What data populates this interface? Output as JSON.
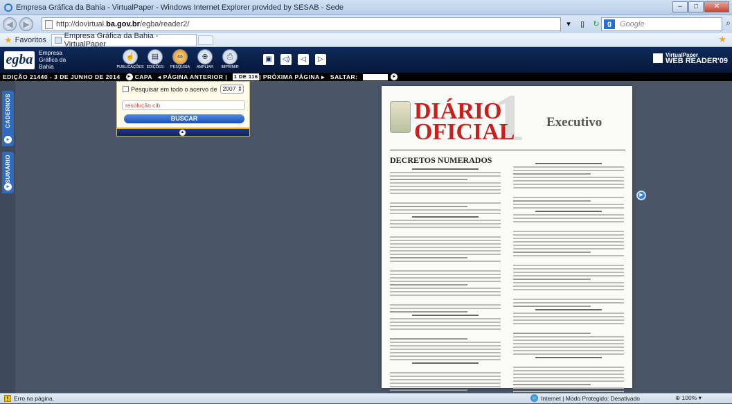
{
  "browser": {
    "title": "Empresa Gráfica da Bahia - VirtualPaper - Windows Internet Explorer provided by SESAB - Sede",
    "url_prefix": "http://dovirtual.",
    "url_domain": "ba.gov.br",
    "url_suffix": "/egba/reader2/",
    "search_placeholder": "Google",
    "favorites_label": "Favoritos",
    "tab_title": "Empresa Gráfica da Bahia - VirtualPaper",
    "status_left": "Erro na página.",
    "status_right": "Internet | Modo Protegido: Desativado",
    "zoom": "100%"
  },
  "app": {
    "logo": "egba",
    "logo_text_1": "Empresa",
    "logo_text_2": "Gráfica da",
    "logo_text_3": "Bahia",
    "tools": [
      {
        "label": "PUBLICAÇÕES",
        "icon": "hand-pointer-icon"
      },
      {
        "label": "EDIÇÕES",
        "icon": "newspaper-icon"
      },
      {
        "label": "PESQUISA",
        "icon": "binoculars-icon"
      },
      {
        "label": "AMPLIAR",
        "icon": "zoom-icon"
      },
      {
        "label": "IMPRIMIR",
        "icon": "printer-icon"
      }
    ],
    "vp_title": "VirtualPaper",
    "vp_sub": "WEB READER",
    "vp_ver": "'09"
  },
  "editbar": {
    "edition": "EDIÇÃO 21440 - 3 DE JUNHO DE 2014",
    "capa": "CAPA",
    "prev": "◂ PÁGINA ANTERIOR |",
    "page": "1 DE 116",
    "next": "| PRÓXIMA PÁGINA ▸",
    "jump": "SALTAR:"
  },
  "sidebar": {
    "cadernos": "CADERNOS",
    "sumario": "SUMÁRIO"
  },
  "search_panel": {
    "checkbox_label": "Pesquisar em todo o acervo de",
    "year": "2007",
    "query": "resolução cib",
    "button": "BUSCAR"
  },
  "paper": {
    "masthead_1": "DIÁRIO",
    "masthead_2": "OFICIAL",
    "section": "Executivo",
    "number": "1",
    "decretos": "DECRETOS NUMERADOS"
  }
}
